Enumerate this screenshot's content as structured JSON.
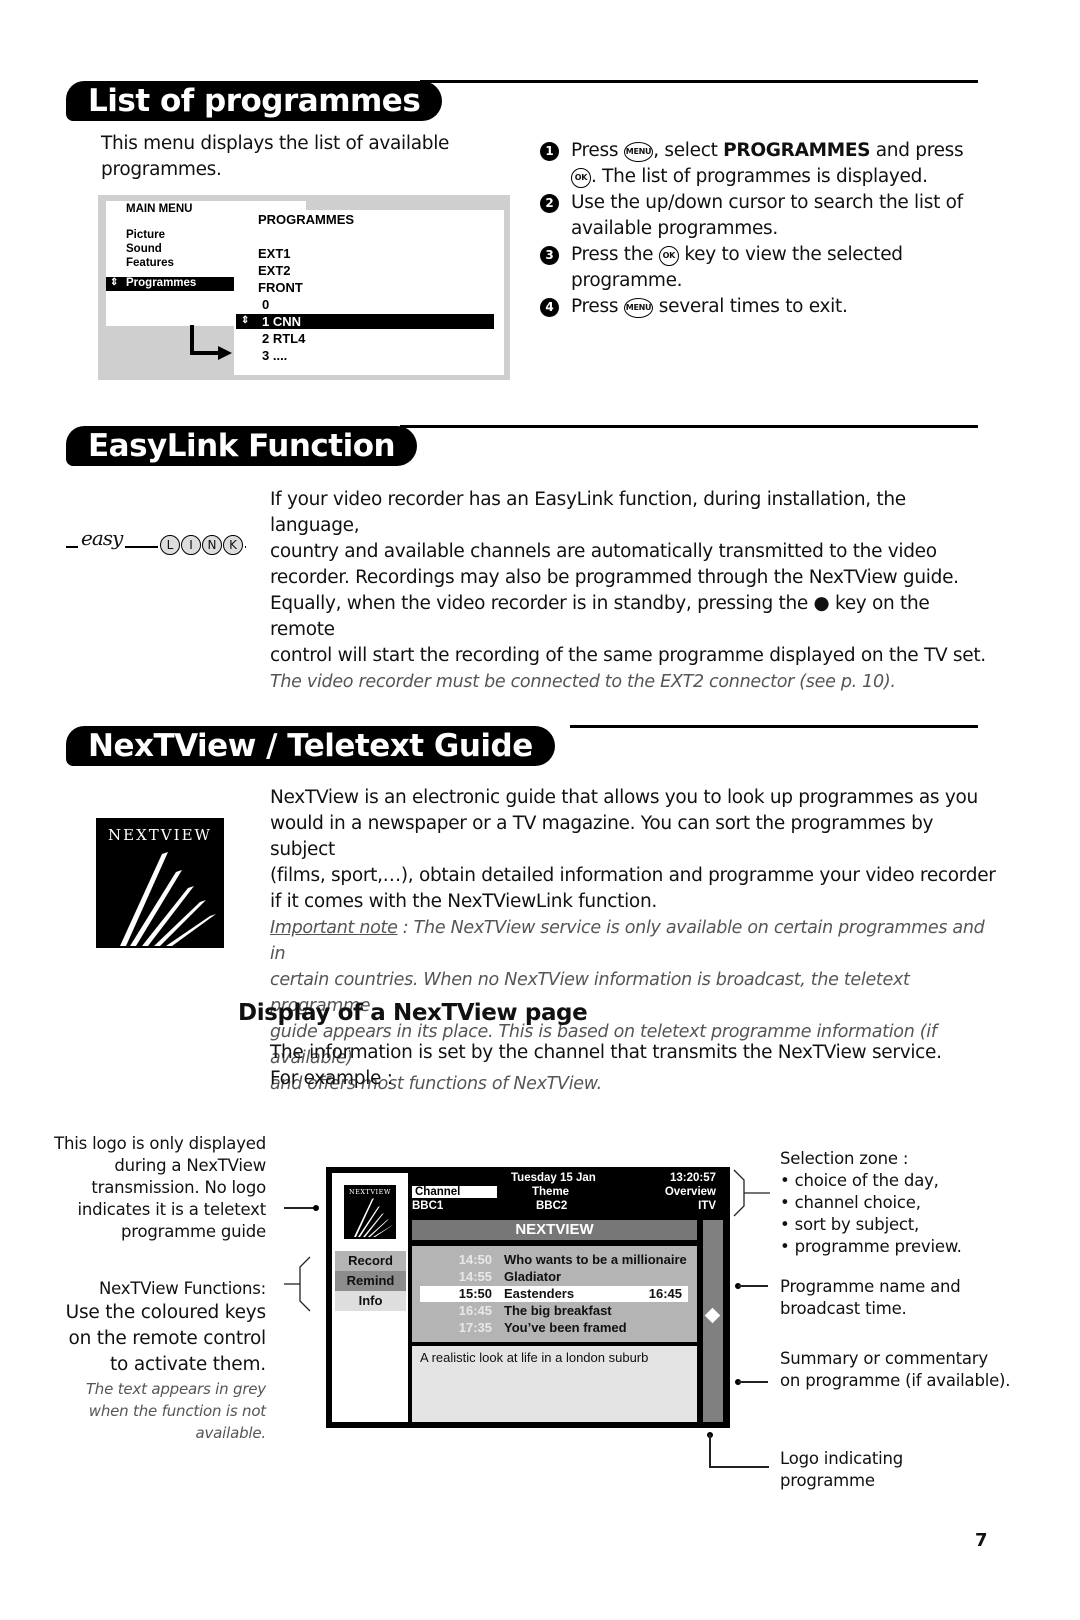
{
  "page_number": "7",
  "list_of_programmes": {
    "title": "List of programmes",
    "intro": [
      "This menu displays the list of available",
      "programmes."
    ],
    "main_menu": {
      "title": "MAIN MENU",
      "items": [
        "Picture",
        "Sound",
        "Features",
        "Programmes"
      ],
      "selected": "Programmes"
    },
    "programmes_menu": {
      "title": "PROGRAMMES",
      "items": [
        "EXT1",
        "EXT2",
        "FRONT",
        "0",
        "1 CNN",
        "2 RTL4",
        "3 ...."
      ],
      "selected": "1 CNN"
    },
    "steps": [
      {
        "num": "1",
        "parts": [
          "Press ",
          "MENU",
          ", select ",
          "PROGRAMMES",
          " and press"
        ],
        "line2_key": "OK",
        "line2": ". The list of programmes is displayed."
      },
      {
        "num": "2",
        "line1": "Use the up/down cursor to search the list of",
        "line2": "available programmes."
      },
      {
        "num": "3",
        "line1_a": "Press the ",
        "key": "OK",
        "line1_b": " key to view the selected",
        "line2": "programme."
      },
      {
        "num": "4",
        "line1_a": "Press ",
        "key": "MENU",
        "line1_b": " several times to exit."
      }
    ]
  },
  "easylink": {
    "title": "EasyLink Function",
    "logo_script": "easy",
    "logo_letters": [
      "L",
      "I",
      "N",
      "K"
    ],
    "paragraph": [
      "If your video recorder has an EasyLink function, during installation, the language,",
      "country and available channels are automatically transmitted to the video",
      "recorder. Recordings may also be programmed through the NexTView guide.",
      "Equally, when the video recorder is in standby, pressing the ● key on the remote",
      "control will start the recording of the same programme displayed on the TV set."
    ],
    "note": "The video recorder must be connected to the EXT2 connector (see p. 10)."
  },
  "nextview": {
    "title": "NexTView / Teletext Guide",
    "logo_text": "NEXTVIEW",
    "paragraph": [
      "NexTView is an electronic guide that allows you to look up programmes as you",
      "would in a newspaper or a TV magazine. You can sort the programmes by subject",
      "(films, sport,…), obtain detailed information and programme your video recorder",
      "if it comes with the NexTViewLink function."
    ],
    "note_label": "Important note",
    "note_lines": [
      " : The NexTView service is only available on certain programmes and in",
      "certain countries. When no NexTView information is broadcast, the teletext programme",
      "guide appears in its place. This is based on teletext programme information (if available)",
      "and offers most functions of NexTView."
    ],
    "subheading": "Display of a NexTView page",
    "sub_text": [
      "The information is set by the channel that transmits the NexTView service.",
      "For example :"
    ]
  },
  "tv_screen": {
    "logo_text": "NEXTVIEW",
    "date": "Tuesday 15 Jan",
    "clock": "13:20:57",
    "tabs": [
      "Channel",
      "Theme",
      "Overview"
    ],
    "channels": [
      "BBC1",
      "BBC2",
      "ITV"
    ],
    "banner": "NEXTVIEW",
    "functions": [
      "Record",
      "Remind",
      "Info"
    ],
    "programmes": [
      {
        "time": "14:50",
        "name": "Who wants to be a millionaire",
        "end": ""
      },
      {
        "time": "14:55",
        "name": "Gladiator",
        "end": ""
      },
      {
        "time": "15:50",
        "name": "Eastenders",
        "end": "16:45"
      },
      {
        "time": "16:45",
        "name": "The big breakfast",
        "end": ""
      },
      {
        "time": "17:35",
        "name": "You’ve been framed",
        "end": ""
      }
    ],
    "selected_index": 2,
    "summary": "A realistic look at life in a london suburb"
  },
  "annotations": {
    "logo_note": [
      "This logo is only displayed",
      "during a NexTView",
      "transmission. No logo",
      "indicates it is a teletext",
      "programme guide"
    ],
    "functions_label": "NexTView Functions:",
    "functions_text": [
      "Use the coloured keys",
      "on the remote control",
      "to activate them."
    ],
    "functions_note": [
      "The text appears in grey",
      "when the function is not",
      "available."
    ],
    "selection_zone": [
      "Selection zone :",
      "• choice of the day,",
      "• channel choice,",
      "• sort by subject,",
      "• programme preview."
    ],
    "programme_name": [
      "Programme name and",
      "broadcast time."
    ],
    "summary": [
      "Summary or commentary",
      "on programme (if available)."
    ],
    "logo_indicating": [
      "Logo indicating",
      "programme"
    ]
  }
}
